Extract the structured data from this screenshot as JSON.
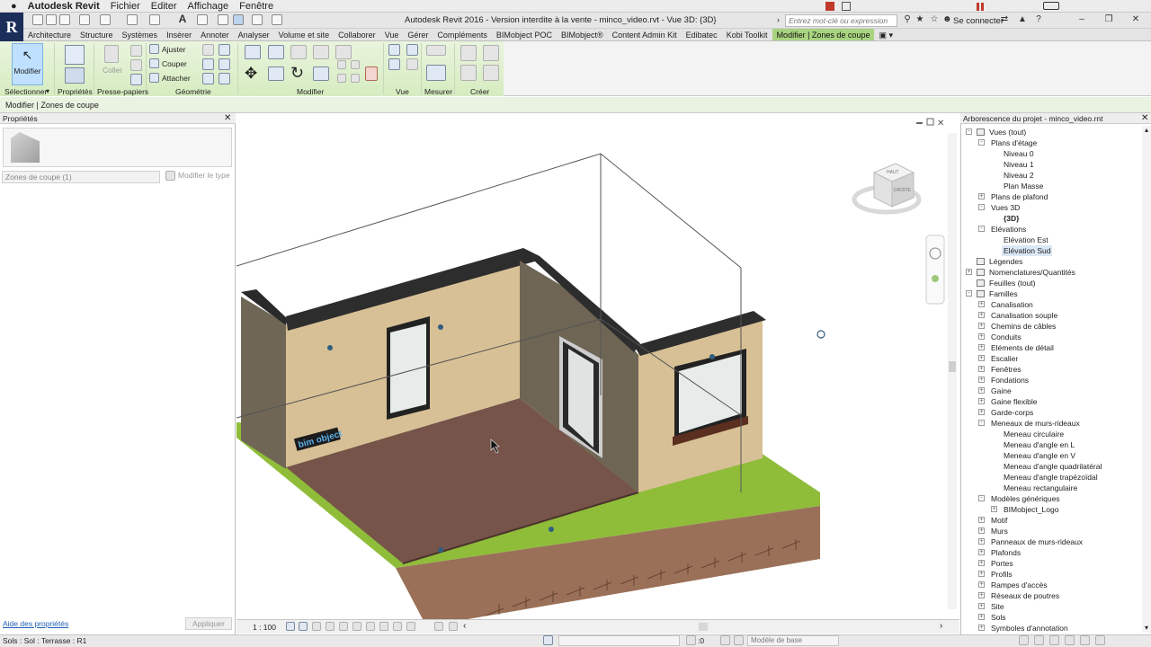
{
  "mac_menu": {
    "app": "Autodesk Revit",
    "items": [
      "Fichier",
      "Editer",
      "Affichage",
      "Fenêtre"
    ]
  },
  "title": "Autodesk Revit 2016 - Version interdite à la vente -    minco_video.rvt - Vue 3D: {3D}",
  "search": {
    "placeholder": "Entrez mot-clé ou expression"
  },
  "sign_in": "Se connecter",
  "tabs": [
    "Architecture",
    "Structure",
    "Systèmes",
    "Insérer",
    "Annoter",
    "Analyser",
    "Volume et site",
    "Collaborer",
    "Vue",
    "Gérer",
    "Compléments",
    "BIMobject POC",
    "BIMobject®",
    "Content Admin Kit",
    "Edibatec",
    "Kobi Toolkit",
    "Modifier | Zones de coupe"
  ],
  "ribbon": {
    "modify": "Modifier",
    "coller": "Coller",
    "ajuster": "Ajuster",
    "couper": "Couper",
    "attacher": "Attacher",
    "panels": [
      "Sélectionner",
      "Propriétés",
      "Presse-papiers",
      "Géométrie",
      "Modifier",
      "Vue",
      "Mesurer",
      "Créer"
    ]
  },
  "options_bar": "Modifier | Zones de coupe",
  "properties": {
    "title": "Propriétés",
    "selector": "Zones de coupe (1)",
    "edit_type": "Modifier le type",
    "help": "Aide des propriétés",
    "apply": "Appliquer"
  },
  "view": {
    "scale": "1 : 100",
    "cube_top": "HAUT",
    "cube_face": "DROITE",
    "logo": "bim object"
  },
  "browser": {
    "title": "Arborescence du projet - minco_video.rnt",
    "tree": [
      {
        "label": "Vues (tout)",
        "lvl": 0,
        "exp": "-",
        "icon": true
      },
      {
        "label": "Plans d'étage",
        "lvl": 1,
        "exp": "-"
      },
      {
        "label": "Niveau 0",
        "lvl": 2
      },
      {
        "label": "Niveau 1",
        "lvl": 2
      },
      {
        "label": "Niveau 2",
        "lvl": 2
      },
      {
        "label": "Plan Masse",
        "lvl": 2
      },
      {
        "label": "Plans de plafond",
        "lvl": 1,
        "exp": "+"
      },
      {
        "label": "Vues 3D",
        "lvl": 1,
        "exp": "-"
      },
      {
        "label": "{3D}",
        "lvl": 2,
        "bold": true
      },
      {
        "label": "Elévations",
        "lvl": 1,
        "exp": "-"
      },
      {
        "label": "Elévation Est",
        "lvl": 2
      },
      {
        "label": "Elévation Sud",
        "lvl": 2,
        "sel": true
      },
      {
        "label": "Légendes",
        "lvl": 0,
        "icon": true
      },
      {
        "label": "Nomenclatures/Quantités",
        "lvl": 0,
        "exp": "+",
        "icon": true
      },
      {
        "label": "Feuilles (tout)",
        "lvl": 0,
        "icon": true
      },
      {
        "label": "Familles",
        "lvl": 0,
        "exp": "-",
        "icon": true
      },
      {
        "label": "Canalisation",
        "lvl": 1,
        "exp": "+"
      },
      {
        "label": "Canalisation souple",
        "lvl": 1,
        "exp": "+"
      },
      {
        "label": "Chemins de câbles",
        "lvl": 1,
        "exp": "+"
      },
      {
        "label": "Conduits",
        "lvl": 1,
        "exp": "+"
      },
      {
        "label": "Eléments de détail",
        "lvl": 1,
        "exp": "+"
      },
      {
        "label": "Escalier",
        "lvl": 1,
        "exp": "+"
      },
      {
        "label": "Fenêtres",
        "lvl": 1,
        "exp": "+"
      },
      {
        "label": "Fondations",
        "lvl": 1,
        "exp": "+"
      },
      {
        "label": "Gaine",
        "lvl": 1,
        "exp": "+"
      },
      {
        "label": "Gaine flexible",
        "lvl": 1,
        "exp": "+"
      },
      {
        "label": "Garde-corps",
        "lvl": 1,
        "exp": "+"
      },
      {
        "label": "Meneaux de murs-rideaux",
        "lvl": 1,
        "exp": "-"
      },
      {
        "label": "Meneau circulaire",
        "lvl": 2
      },
      {
        "label": "Meneau d'angle en L",
        "lvl": 2
      },
      {
        "label": "Meneau d'angle en V",
        "lvl": 2
      },
      {
        "label": "Meneau d'angle quadrilatéral",
        "lvl": 2
      },
      {
        "label": "Meneau d'angle trapézoïdal",
        "lvl": 2
      },
      {
        "label": "Meneau rectangulaire",
        "lvl": 2
      },
      {
        "label": "Modèles génériques",
        "lvl": 1,
        "exp": "-"
      },
      {
        "label": "BIMobject_Logo",
        "lvl": 2,
        "exp": "+"
      },
      {
        "label": "Motif",
        "lvl": 1,
        "exp": "+"
      },
      {
        "label": "Murs",
        "lvl": 1,
        "exp": "+"
      },
      {
        "label": "Panneaux de murs-rideaux",
        "lvl": 1,
        "exp": "+"
      },
      {
        "label": "Plafonds",
        "lvl": 1,
        "exp": "+"
      },
      {
        "label": "Portes",
        "lvl": 1,
        "exp": "+"
      },
      {
        "label": "Profils",
        "lvl": 1,
        "exp": "+"
      },
      {
        "label": "Rampes d'accès",
        "lvl": 1,
        "exp": "+"
      },
      {
        "label": "Réseaux de poutres",
        "lvl": 1,
        "exp": "+"
      },
      {
        "label": "Site",
        "lvl": 1,
        "exp": "+"
      },
      {
        "label": "Sols",
        "lvl": 1,
        "exp": "+"
      },
      {
        "label": "Symboles d'annotation",
        "lvl": 1,
        "exp": "+"
      }
    ]
  },
  "status": {
    "text": "Sols : Sol : Terrasse : R1",
    "zero": ":0",
    "model": "Modèle de base"
  }
}
